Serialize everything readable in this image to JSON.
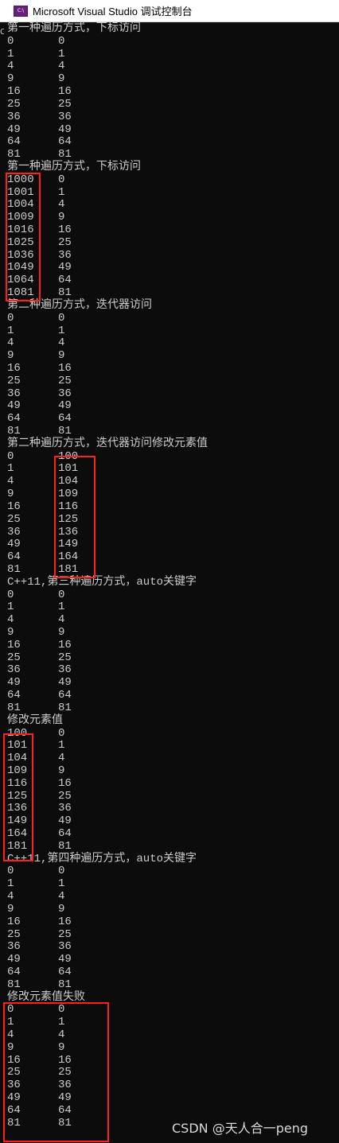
{
  "window": {
    "title": "Microsoft Visual Studio 调试控制台",
    "icon": "visual-studio-icon",
    "icon_glyph": "C:\\"
  },
  "colors": {
    "console_bg": "#0c0c0c",
    "console_text": "#cccccc",
    "highlight_box": "#ff1f1f"
  },
  "sections": [
    {
      "header": "第一种遍历方式，下标访问",
      "rows": [
        [
          "0",
          "0"
        ],
        [
          "1",
          "1"
        ],
        [
          "4",
          "4"
        ],
        [
          "9",
          "9"
        ],
        [
          "16",
          "16"
        ],
        [
          "25",
          "25"
        ],
        [
          "36",
          "36"
        ],
        [
          "49",
          "49"
        ],
        [
          "64",
          "64"
        ],
        [
          "81",
          "81"
        ]
      ]
    },
    {
      "header": "第一种遍历方式，下标访问",
      "rows": [
        [
          "1000",
          "0"
        ],
        [
          "1001",
          "1"
        ],
        [
          "1004",
          "4"
        ],
        [
          "1009",
          "9"
        ],
        [
          "1016",
          "16"
        ],
        [
          "1025",
          "25"
        ],
        [
          "1036",
          "36"
        ],
        [
          "1049",
          "49"
        ],
        [
          "1064",
          "64"
        ],
        [
          "1081",
          "81"
        ]
      ]
    },
    {
      "header": "第二种遍历方式，迭代器访问",
      "rows": [
        [
          "0",
          "0"
        ],
        [
          "1",
          "1"
        ],
        [
          "4",
          "4"
        ],
        [
          "9",
          "9"
        ],
        [
          "16",
          "16"
        ],
        [
          "25",
          "25"
        ],
        [
          "36",
          "36"
        ],
        [
          "49",
          "49"
        ],
        [
          "64",
          "64"
        ],
        [
          "81",
          "81"
        ]
      ]
    },
    {
      "header": "第二种遍历方式，迭代器访问修改元素值",
      "rows": [
        [
          "0",
          "100"
        ],
        [
          "1",
          "101"
        ],
        [
          "4",
          "104"
        ],
        [
          "9",
          "109"
        ],
        [
          "16",
          "116"
        ],
        [
          "25",
          "125"
        ],
        [
          "36",
          "136"
        ],
        [
          "49",
          "149"
        ],
        [
          "64",
          "164"
        ],
        [
          "81",
          "181"
        ]
      ]
    },
    {
      "header": "C++11,第三种遍历方式，auto关键字",
      "rows": [
        [
          "0",
          "0"
        ],
        [
          "1",
          "1"
        ],
        [
          "4",
          "4"
        ],
        [
          "9",
          "9"
        ],
        [
          "16",
          "16"
        ],
        [
          "25",
          "25"
        ],
        [
          "36",
          "36"
        ],
        [
          "49",
          "49"
        ],
        [
          "64",
          "64"
        ],
        [
          "81",
          "81"
        ]
      ]
    },
    {
      "header": "修改元素值",
      "rows": [
        [
          "100",
          "0"
        ],
        [
          "101",
          "1"
        ],
        [
          "104",
          "4"
        ],
        [
          "109",
          "9"
        ],
        [
          "116",
          "16"
        ],
        [
          "125",
          "25"
        ],
        [
          "136",
          "36"
        ],
        [
          "149",
          "49"
        ],
        [
          "164",
          "64"
        ],
        [
          "181",
          "81"
        ]
      ]
    },
    {
      "header": "C++11,第四种遍历方式，auto关键字",
      "rows": [
        [
          "0",
          "0"
        ],
        [
          "1",
          "1"
        ],
        [
          "4",
          "4"
        ],
        [
          "9",
          "9"
        ],
        [
          "16",
          "16"
        ],
        [
          "25",
          "25"
        ],
        [
          "36",
          "36"
        ],
        [
          "49",
          "49"
        ],
        [
          "64",
          "64"
        ],
        [
          "81",
          "81"
        ]
      ]
    },
    {
      "header": "修改元素值失败",
      "rows": [
        [
          "0",
          "0"
        ],
        [
          "1",
          "1"
        ],
        [
          "4",
          "4"
        ],
        [
          "9",
          "9"
        ],
        [
          "16",
          "16"
        ],
        [
          "25",
          "25"
        ],
        [
          "36",
          "36"
        ],
        [
          "49",
          "49"
        ],
        [
          "64",
          "64"
        ],
        [
          "81",
          "81"
        ]
      ]
    }
  ],
  "watermark": "CSDN @天人合一peng"
}
